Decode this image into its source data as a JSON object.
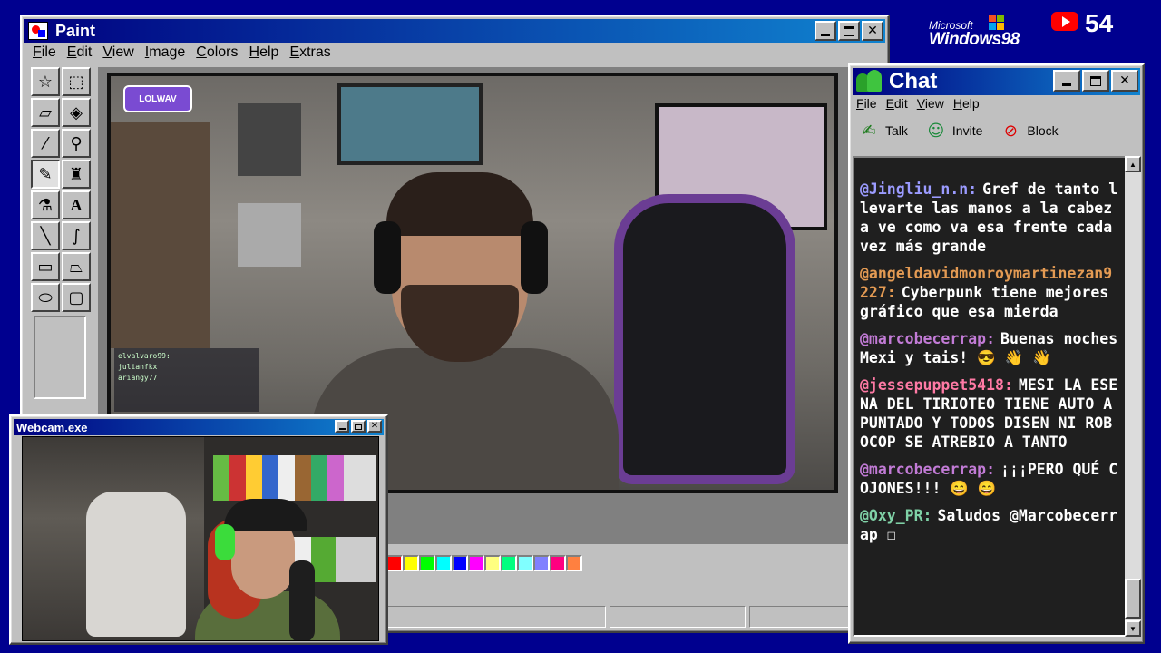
{
  "paint": {
    "title": "Paint",
    "menu": [
      "File",
      "Edit",
      "View",
      "Image",
      "Colors",
      "Help",
      "Extras"
    ],
    "tools": [
      "free-select",
      "rect-select",
      "eraser",
      "fill",
      "color-picker",
      "magnifier",
      "pencil",
      "brush",
      "airbrush",
      "text",
      "line",
      "curve",
      "rectangle",
      "polygon",
      "ellipse",
      "rounded-rect"
    ],
    "active_tool": "pencil",
    "stream_logo": "LOLWAV",
    "overlay_chat": [
      "elvalvaro99:",
      "julianfkx",
      "ariangy77"
    ],
    "palette": [
      "#ff0000",
      "#ffff00",
      "#00ff00",
      "#00ffff",
      "#0000ff",
      "#ff00ff",
      "#ffff80",
      "#00ff80",
      "#80ffff",
      "#8080ff",
      "#ff0080",
      "#ff8040"
    ]
  },
  "branding": {
    "ms": "Microsoft",
    "win": "Windows98",
    "youtube_count": "54"
  },
  "chat": {
    "title": "Chat",
    "menu": [
      "File",
      "Edit",
      "View",
      "Help"
    ],
    "toolbar": [
      {
        "label": "Talk",
        "icon": "talk-icon"
      },
      {
        "label": "Invite",
        "icon": "invite-icon"
      },
      {
        "label": "Block",
        "icon": "block-icon"
      }
    ],
    "messages": [
      {
        "user": "@Jingliu_n.n:",
        "color": "#9b9bff",
        "text": "Gref de tanto llevarte las manos a la cabeza ve como va esa frente cada vez más grande"
      },
      {
        "user": "@angeldavidmonroymartinezan9227:",
        "color": "#e39a53",
        "text": "Cyberpunk tiene mejores gráfico que esa mierda"
      },
      {
        "user": "@marcobecerrap:",
        "color": "#c27bd6",
        "text": "Buenas noches Mexi y tais! 😎 👋 👋"
      },
      {
        "user": "@jessepuppet5418:",
        "color": "#ff7aa5",
        "text": "MESI LA ESENA DEL TIRIOTEO TIENE AUTO APUNTADO Y TODOS DISEN NI ROBOCOP SE ATREBIO A TANTO"
      },
      {
        "user": "@marcobecerrap:",
        "color": "#c27bd6",
        "text": "¡¡¡PERO QUÉ COJONES!!! 😄 😄"
      },
      {
        "user": "@Oxy_PR:",
        "color": "#7fd1a6",
        "text": "Saludos @Marcobecerrap ☐"
      }
    ]
  },
  "webcam": {
    "title": "Webcam.exe"
  }
}
